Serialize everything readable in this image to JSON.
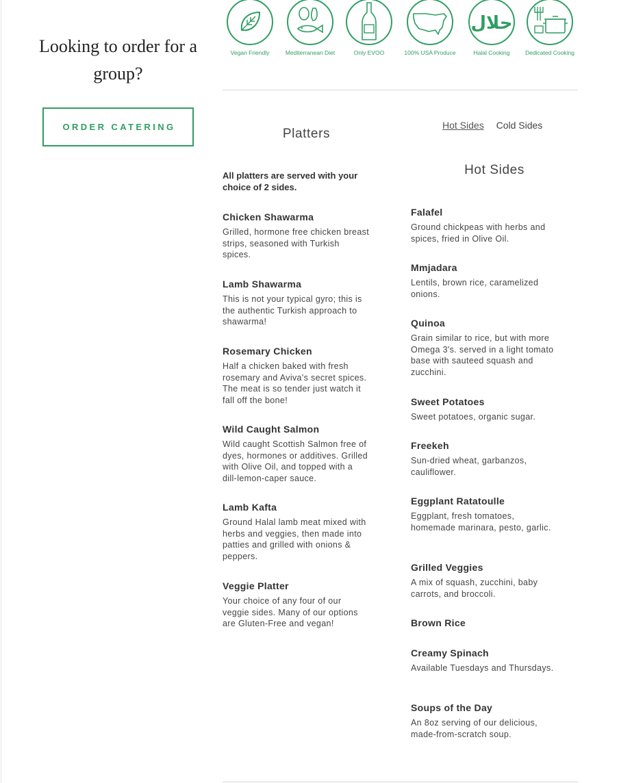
{
  "brand": {
    "accent": "#2f9e63"
  },
  "catering": {
    "title": "Looking to order for a group?",
    "button_label": "ORDER CATERING"
  },
  "badges": [
    {
      "icon": "leaf-icon",
      "label": "Vegan Friendly"
    },
    {
      "icon": "olive-fish-icon",
      "label": "Mediterranean Diet"
    },
    {
      "icon": "olive-oil-bottle-icon",
      "label": "Only EVOO"
    },
    {
      "icon": "usa-map-icon",
      "label": "100% USA Produce"
    },
    {
      "icon": "halal-icon",
      "label": "Halal Cooking",
      "glyph": "حلال"
    },
    {
      "icon": "cooking-pot-icon",
      "label": "Dedicated Cooking"
    }
  ],
  "platters": {
    "title": "Platters",
    "intro": "All platters are served with your choice of 2 sides.",
    "items": [
      {
        "name": "Chicken Shawarma",
        "desc": "Grilled, hormone free chicken breast strips, seasoned with Turkish spices."
      },
      {
        "name": "Lamb Shawarma",
        "desc": "This is not your typical gyro; this is the authentic Turkish approach to shawarma!"
      },
      {
        "name": "Rosemary Chicken",
        "desc": "Half a chicken baked with fresh rosemary and Aviva's secret spices. The meat is so tender just watch it fall off the bone!"
      },
      {
        "name": "Wild Caught Salmon",
        "desc": "Wild caught Scottish Salmon free of dyes, hormones or additives. Grilled with Olive Oil, and topped with a dill-lemon-caper sauce."
      },
      {
        "name": "Lamb Kafta",
        "desc": "Ground Halal lamb meat mixed with herbs and veggies, then made into patties and grilled with onions & peppers."
      },
      {
        "name": "Veggie Platter",
        "desc": "Your choice of any four of our veggie sides. Many of our options are Gluten-Free and vegan!"
      }
    ]
  },
  "sides": {
    "tabs": [
      {
        "label": "Hot Sides",
        "active": true
      },
      {
        "label": "Cold Sides",
        "active": false
      }
    ],
    "title": "Hot Sides",
    "items": [
      {
        "name": "Falafel",
        "desc": "Ground chickpeas with herbs and spices, fried in Olive Oil."
      },
      {
        "name": "Mmjadara",
        "desc": "Lentils, brown rice, caramelized onions."
      },
      {
        "name": "Quinoa",
        "desc": "Grain similar to rice, but with more Omega 3's. served in a light tomato base with sauteed squash and zucchini."
      },
      {
        "name": "Sweet Potatoes",
        "desc": "Sweet potatoes, organic sugar."
      },
      {
        "name": "Freekeh",
        "desc": "Sun-dried wheat, garbanzos, cauliflower."
      },
      {
        "name": "Eggplant Ratatoulle",
        "desc": "Eggplant, fresh tomatoes, homemade marinara, pesto, garlic."
      },
      {
        "name": "Grilled Veggies",
        "desc": "A mix of squash, zucchini, baby carrots, and broccoli."
      },
      {
        "name": "Brown Rice",
        "desc": ""
      },
      {
        "name": "Creamy Spinach",
        "desc": "Available Tuesdays and Thursdays."
      },
      {
        "name": "Soups of the Day",
        "desc": "An 8oz serving of our delicious, made-from-scratch soup."
      }
    ]
  }
}
